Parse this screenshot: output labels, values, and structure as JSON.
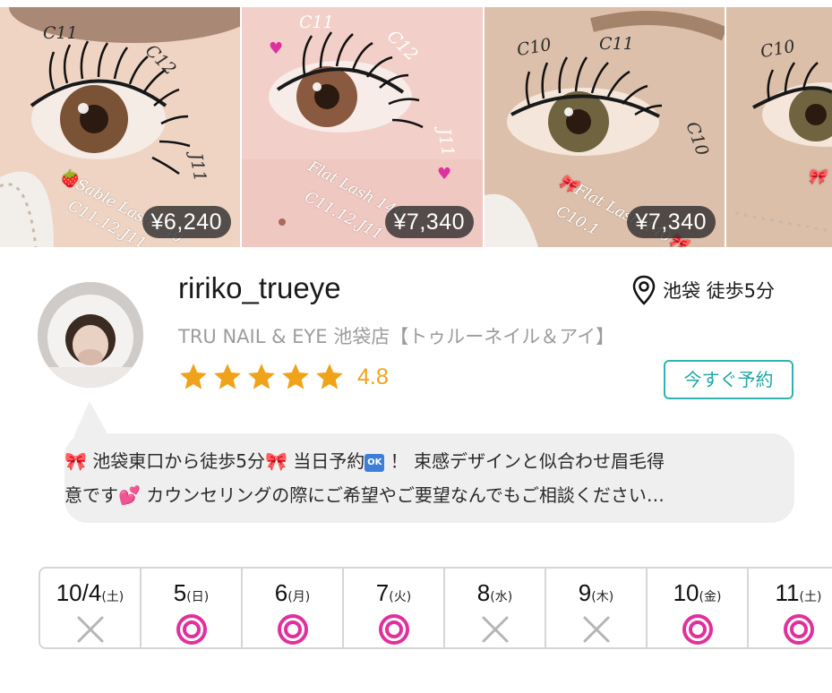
{
  "photos": [
    {
      "price": "¥6,240",
      "labels": [
        "C11",
        "C12",
        "J11"
      ],
      "overlay": "🍓Sable Lash 140",
      "overlay2": "C11.12.J11"
    },
    {
      "price": "¥7,340",
      "labels": [
        "C11",
        "C12",
        "J11"
      ],
      "overlay": "Flat Lash 140",
      "overlay2": "C11.12.J11"
    },
    {
      "price": "¥7,340",
      "labels": [
        "C10",
        "C11",
        "C10"
      ],
      "overlay": "🎀Flat Lash 140🎀",
      "overlay2": "C10.1"
    },
    {
      "price": "",
      "labels": [
        "C10"
      ],
      "overlay": "🎀",
      "overlay2": ""
    }
  ],
  "profile": {
    "username": "ririko_trueye",
    "location": "池袋 徒歩5分",
    "salon": "TRU NAIL & EYE 池袋店【トゥルーネイル＆アイ】",
    "rating": "4.8",
    "stars": 5,
    "reserve_label": "今すぐ予約"
  },
  "bubble": {
    "line1_a": "🎀 池袋東口から徒歩5分🎀 当日予約",
    "ok_badge": "OK",
    "line1_b": " ！ 束感デザインと似合わせ眉毛得",
    "line2": "意です💕 カウンセリングの際にご希望やご要望なんでもご相談ください…"
  },
  "calendar": [
    {
      "num": "10/4",
      "wd": "(土)",
      "status": "unavailable"
    },
    {
      "num": "5",
      "wd": "(日)",
      "status": "available"
    },
    {
      "num": "6",
      "wd": "(月)",
      "status": "available"
    },
    {
      "num": "7",
      "wd": "(火)",
      "status": "available"
    },
    {
      "num": "8",
      "wd": "(水)",
      "status": "unavailable"
    },
    {
      "num": "9",
      "wd": "(木)",
      "status": "unavailable"
    },
    {
      "num": "10",
      "wd": "(金)",
      "status": "available"
    },
    {
      "num": "11",
      "wd": "(土)",
      "status": "available"
    }
  ],
  "colors": {
    "star": "#f0a21a",
    "reserve_border": "#2fb3b0",
    "available_mark": "#e0309e",
    "unavailable_mark": "#b5b5b5"
  }
}
